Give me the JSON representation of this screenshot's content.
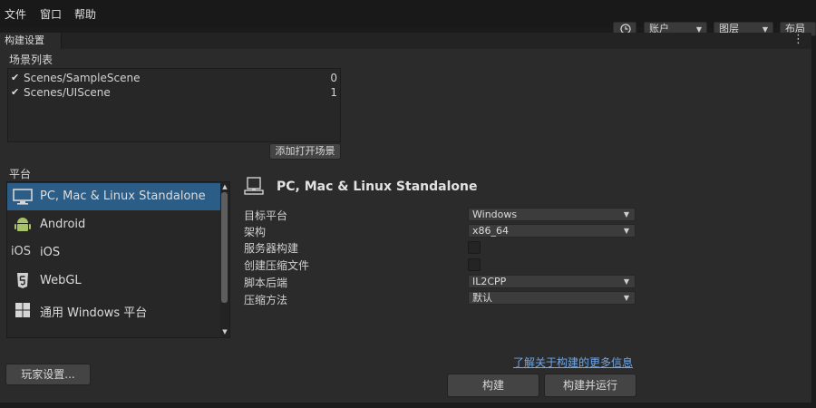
{
  "menu": [
    "文件",
    "窗口",
    "帮助"
  ],
  "toolbar": {
    "account_label": "账户",
    "layers_label": "图层",
    "layout_label": "布局"
  },
  "window": {
    "tab_title": "构建设置",
    "menu_icon": "⋮"
  },
  "scenes": {
    "label": "场景列表",
    "items": [
      {
        "name": "Scenes/SampleScene",
        "index": "0",
        "checked": true
      },
      {
        "name": "Scenes/UIScene",
        "index": "1",
        "checked": true
      }
    ],
    "add_button": "添加打开场景"
  },
  "platforms": {
    "label": "平台",
    "selected": "PC, Mac & Linux Standalone",
    "items": [
      {
        "label": "PC, Mac & Linux Standalone",
        "icon": "monitor-icon"
      },
      {
        "label": "Android",
        "icon": "android-icon"
      },
      {
        "label": "iOS",
        "icon": "ios-icon",
        "icon_text": "iOS"
      },
      {
        "label": "WebGL",
        "icon": "html5-icon"
      },
      {
        "label": "通用 Windows 平台",
        "icon": "windows-icon"
      }
    ]
  },
  "settings": {
    "title": "PC, Mac & Linux Standalone",
    "target_platform": {
      "label": "目标平台",
      "value": "Windows"
    },
    "architecture": {
      "label": "架构",
      "value": "x86_64"
    },
    "server_build": {
      "label": "服务器构建",
      "checked": false
    },
    "compressed": {
      "label": "创建压缩文件",
      "checked": false
    },
    "scripting_backend": {
      "label": "脚本后端",
      "value": "IL2CPP"
    },
    "compression": {
      "label": "压缩方法",
      "value": "默认"
    }
  },
  "learn_more": "了解关于构建的更多信息",
  "buttons": {
    "player_settings": "玩家设置...",
    "build": "构建",
    "build_and_run": "构建并运行"
  },
  "colors": {
    "selection": "#2c5d87",
    "link": "#6fa7e8",
    "panel_bg": "#2b2b2b"
  }
}
